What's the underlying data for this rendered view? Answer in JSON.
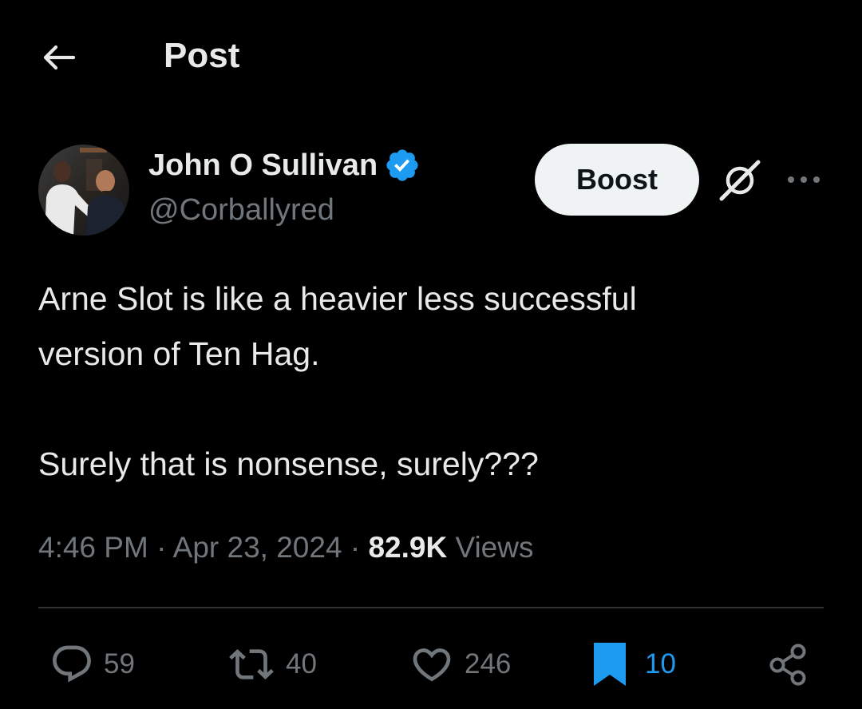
{
  "header": {
    "title": "Post",
    "back_icon": "arrow-left-icon"
  },
  "author": {
    "name": "John O Sullivan",
    "handle": "@Corballyred",
    "verified": true,
    "verified_color": "#1d9bf0"
  },
  "actions_top": {
    "boost_label": "Boost",
    "grok_icon": "grok-icon",
    "more_icon": "more-dots-icon"
  },
  "post": {
    "text_lines": [
      "Arne Slot is like a heavier less successful",
      "version of Ten Hag.",
      "Surely that is nonsense, surely???"
    ]
  },
  "meta": {
    "time": "4:46 PM",
    "separator": "·",
    "date": "Apr 23, 2024",
    "views_count": "82.9K",
    "views_label": "Views"
  },
  "engagement": {
    "replies": "59",
    "reposts": "40",
    "likes": "246",
    "bookmarks": "10",
    "bookmark_color": "#1d9bf0",
    "icon_color": "#71767b"
  },
  "colors": {
    "background": "#000000",
    "text_primary": "#e7e9ea",
    "text_secondary": "#71767b",
    "divider": "#2f3336",
    "boost_bg": "#eff3f4"
  }
}
